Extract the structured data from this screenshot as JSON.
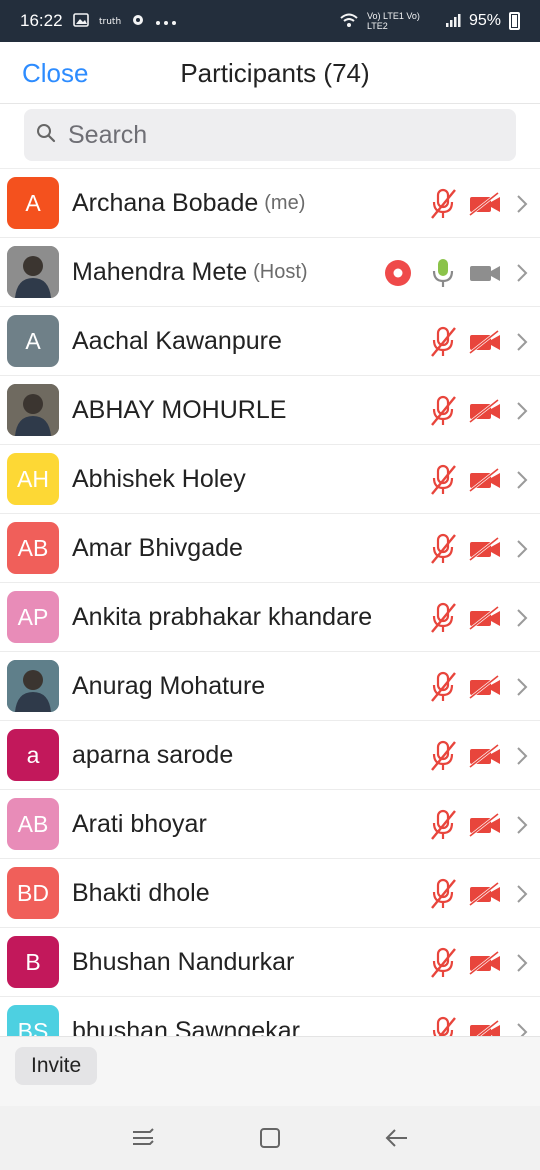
{
  "status_bar": {
    "time": "16:22",
    "battery": "95%",
    "network": "Vo) LTE1 Vo) LTE2",
    "icons": [
      "image-icon",
      "app-icon",
      "cast-icon",
      "more-dots-icon",
      "wifi-icon",
      "signal-icon",
      "battery-icon"
    ]
  },
  "header": {
    "close_label": "Close",
    "title": "Participants (74)"
  },
  "search": {
    "placeholder": "Search"
  },
  "colors": {
    "accent": "#2d8cff",
    "muted_red": "#e8453c",
    "mic_green": "#8bc34a",
    "record_red": "#ef4a4a"
  },
  "participants": [
    {
      "name": "Archana Bobade",
      "tag": "(me)",
      "initials": "A",
      "avatar_color": "#f4511e",
      "photo": false,
      "mic": "muted",
      "video": "off",
      "recording": false
    },
    {
      "name": "Mahendra Mete",
      "tag": "(Host)",
      "initials": "",
      "avatar_color": "#8d8d8d",
      "photo": true,
      "mic": "on",
      "video": "on",
      "recording": true
    },
    {
      "name": "Aachal Kawanpure",
      "tag": "",
      "initials": "A",
      "avatar_color": "#6f8088",
      "photo": false,
      "mic": "muted",
      "video": "off",
      "recording": false
    },
    {
      "name": "ABHAY MOHURLE",
      "tag": "",
      "initials": "",
      "avatar_color": "#6f6a60",
      "photo": true,
      "mic": "muted",
      "video": "off",
      "recording": false
    },
    {
      "name": "Abhishek Holey",
      "tag": "",
      "initials": "AH",
      "avatar_color": "#fdd835",
      "photo": false,
      "mic": "muted",
      "video": "off",
      "recording": false
    },
    {
      "name": "Amar Bhivgade",
      "tag": "",
      "initials": "AB",
      "avatar_color": "#f05f5a",
      "photo": false,
      "mic": "muted",
      "video": "off",
      "recording": false
    },
    {
      "name": "Ankita prabhakar khandare",
      "tag": "",
      "initials": "AP",
      "avatar_color": "#e88cb8",
      "photo": false,
      "mic": "muted",
      "video": "off",
      "recording": false
    },
    {
      "name": "Anurag Mohature",
      "tag": "",
      "initials": "",
      "avatar_color": "#5f7f8a",
      "photo": true,
      "mic": "muted",
      "video": "off",
      "recording": false
    },
    {
      "name": "aparna sarode",
      "tag": "",
      "initials": "a",
      "avatar_color": "#c2185b",
      "photo": false,
      "mic": "muted",
      "video": "off",
      "recording": false
    },
    {
      "name": "Arati bhoyar",
      "tag": "",
      "initials": "AB",
      "avatar_color": "#e88cb8",
      "photo": false,
      "mic": "muted",
      "video": "off",
      "recording": false
    },
    {
      "name": "Bhakti dhole",
      "tag": "",
      "initials": "BD",
      "avatar_color": "#f05f5a",
      "photo": false,
      "mic": "muted",
      "video": "off",
      "recording": false
    },
    {
      "name": "Bhushan Nandurkar",
      "tag": "",
      "initials": "B",
      "avatar_color": "#c2185b",
      "photo": false,
      "mic": "muted",
      "video": "off",
      "recording": false
    },
    {
      "name": "bhushan Sawngekar",
      "tag": "",
      "initials": "BS",
      "avatar_color": "#4dd0e1",
      "photo": false,
      "mic": "muted",
      "video": "off",
      "recording": false
    }
  ],
  "bottom": {
    "invite_label": "Invite"
  },
  "nav": {
    "icons": [
      "recent-apps-icon",
      "home-icon",
      "back-icon"
    ]
  }
}
